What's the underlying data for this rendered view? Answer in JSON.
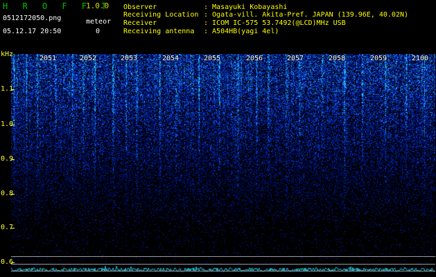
{
  "header": {
    "app_title": "H R O F F T",
    "version": "1.0.0",
    "filename": "0512172050.png",
    "datetime": "05.12.17 20:50",
    "meteor_label": "meteor",
    "meteor_count": "0"
  },
  "info": [
    {
      "label": "Observer",
      "value": ": Masayuki Kobayashi"
    },
    {
      "label": "Receiving Location",
      "value": ": Ogata-vill. Akita-Pref. JAPAN (139.96E, 40.02N)"
    },
    {
      "label": "Receiver",
      "value": ": ICOM IC-575 53.7492(@LCD)MHz USB"
    },
    {
      "label": "Receiving antenna",
      "value": ": A504HB(yagi 4el)"
    }
  ],
  "spectrogram": {
    "unit_label": "kHz",
    "y_ticks": [
      "1.1",
      "1.0",
      "0.9",
      "0.8",
      "0.7",
      "0.6"
    ],
    "x_ticks": [
      "2051",
      "2052",
      "2053",
      "2054",
      "2055",
      "2056",
      "2057",
      "2058",
      "2059",
      "2100"
    ],
    "colors": {
      "noise_dark": "#0a1a8c",
      "noise_bright": "#2a7cff",
      "sparkle": "#30e0ff",
      "trace": "#22c8e0"
    }
  }
}
